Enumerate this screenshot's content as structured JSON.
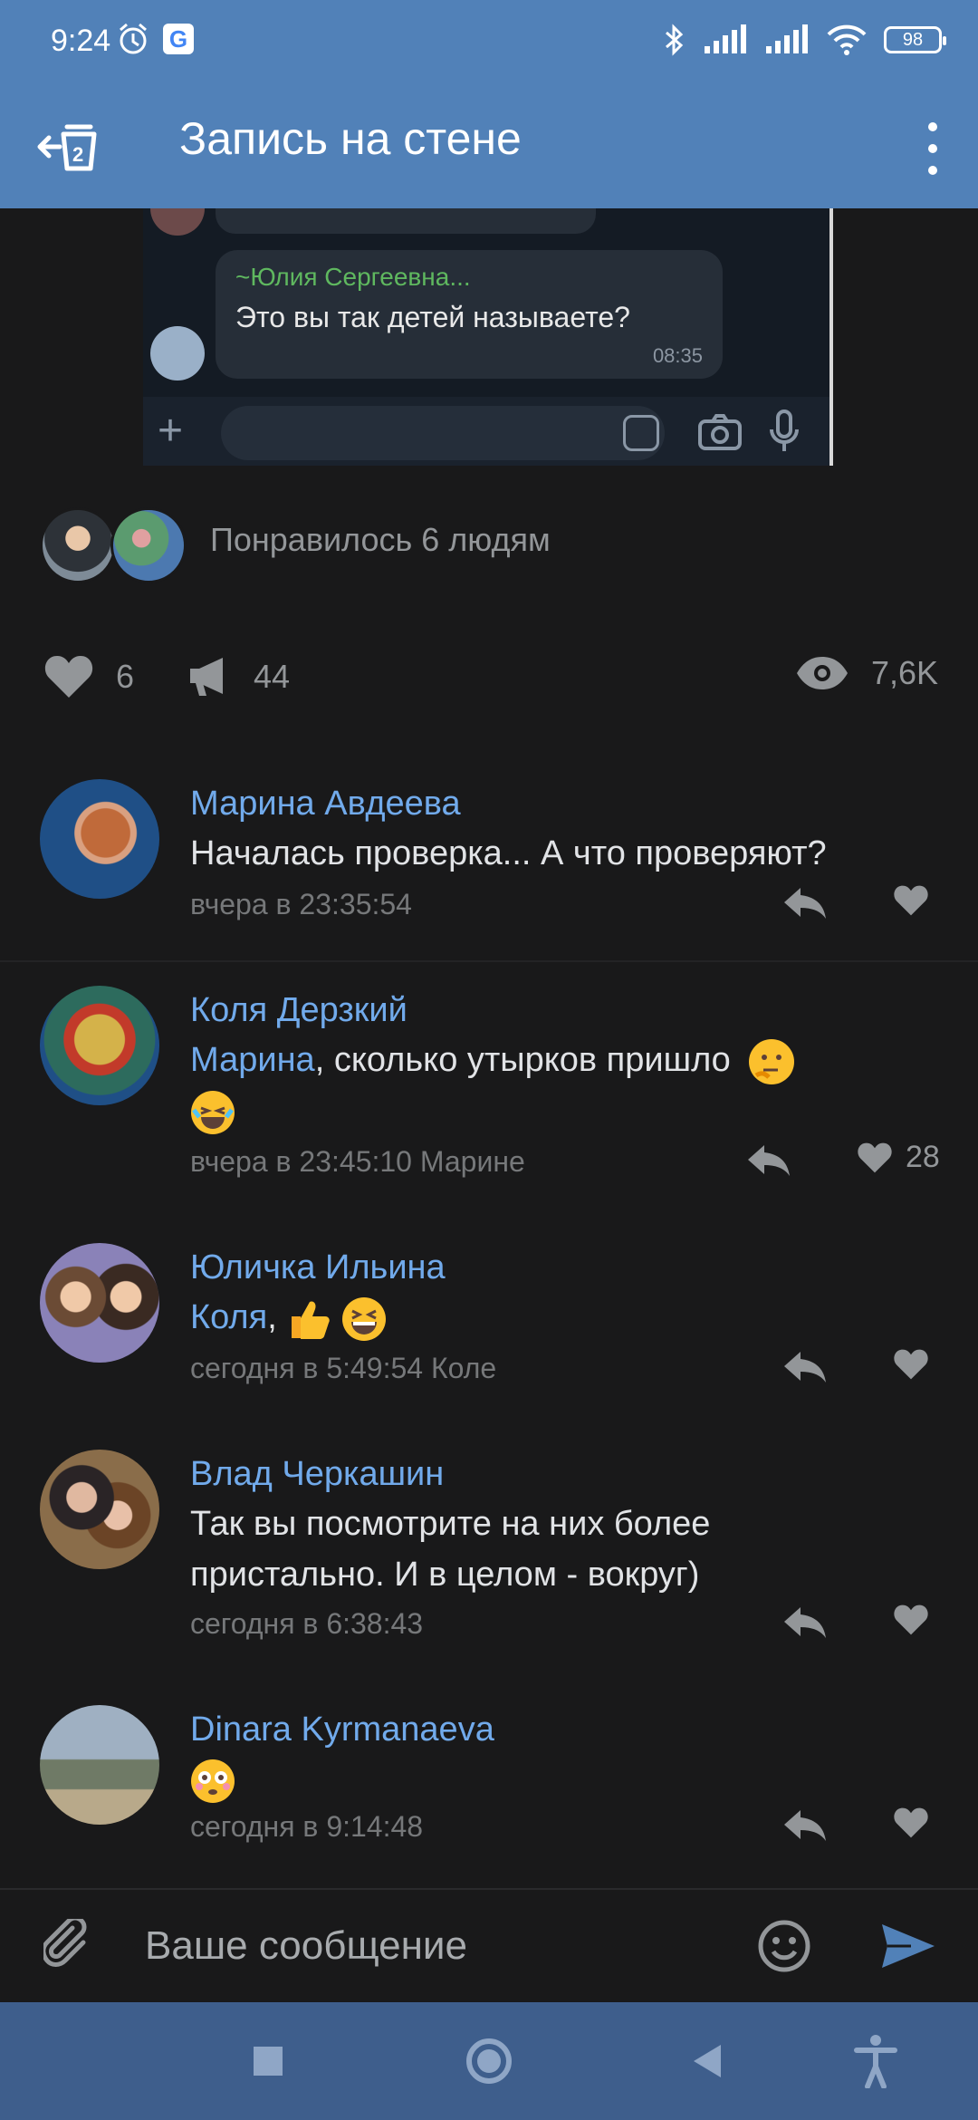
{
  "status_bar": {
    "time": "9:24",
    "battery": "98",
    "google_badge": "G"
  },
  "toolbar": {
    "title": "Запись на стене",
    "back_icon": "back-stack-icon",
    "more_icon": "more-vertical-icon"
  },
  "post_image": {
    "sender": "~Юлия Сергеевна...",
    "message": "Это вы так детей называете?",
    "time": "08:35"
  },
  "likes_strip": {
    "text": "Понравилось 6 людям"
  },
  "stats": {
    "likes": "6",
    "shares": "44",
    "views": "7,6K"
  },
  "comments": [
    {
      "author": "Марина Авдеева",
      "mention": "",
      "text": "Началась проверка... А что проверяют?",
      "meta": "вчера в 23:35:54",
      "likes": ""
    },
    {
      "author": "Коля Дерзкий",
      "mention": "Марина",
      "text": ", сколько утырков пришло",
      "meta": "вчера в 23:45:10 Марине",
      "likes": "28"
    },
    {
      "author": "Юличка Ильина",
      "mention": "Коля",
      "text": ",",
      "meta": "сегодня в 5:49:54 Коле",
      "likes": ""
    },
    {
      "author": "Влад Черкашин",
      "mention": "",
      "text": "Так вы посмотрите на них более пристально. И в целом - вокруг)",
      "meta": "сегодня в 6:38:43",
      "likes": ""
    },
    {
      "author": "Dinara Kyrmanaeva",
      "mention": "",
      "text": "",
      "meta": "сегодня в 9:14:48",
      "likes": ""
    }
  ],
  "composer": {
    "placeholder": "Ваше сообщение"
  },
  "colors": {
    "header": "#5181b8",
    "background": "#19191a",
    "link": "#71aaeb",
    "navbar": "#3e5e8c"
  }
}
